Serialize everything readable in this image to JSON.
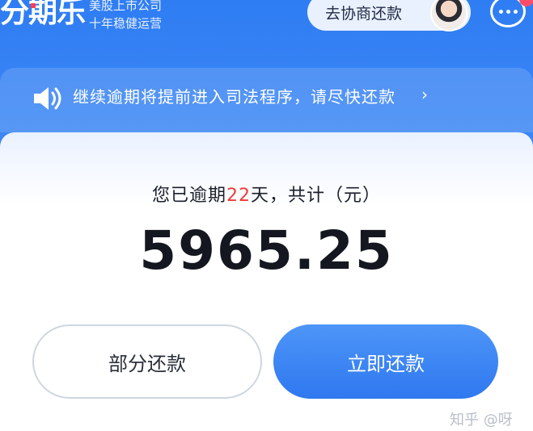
{
  "header": {
    "logo_text": "分期乐",
    "tagline_line1": "美股上市公司",
    "tagline_line2": "十年稳健运营",
    "negotiate_label": "去协商还款",
    "avatar_icon": "agent-avatar",
    "chat_icon": "chat-bubble-icon"
  },
  "notice": {
    "icon": "speaker-icon",
    "text": "继续逾期将提前进入司法程序，请尽快还款",
    "chevron": "›"
  },
  "summary": {
    "prefix": "您已逾期",
    "days": "22",
    "suffix": "天，共计（元）",
    "amount": "5965.25"
  },
  "actions": {
    "partial_label": "部分还款",
    "pay_now_label": "立即还款"
  },
  "watermark": "知乎 @呀",
  "colors": {
    "primary": "#3b86f4",
    "button": "#2f78f0",
    "overdue": "#f03a3a"
  }
}
